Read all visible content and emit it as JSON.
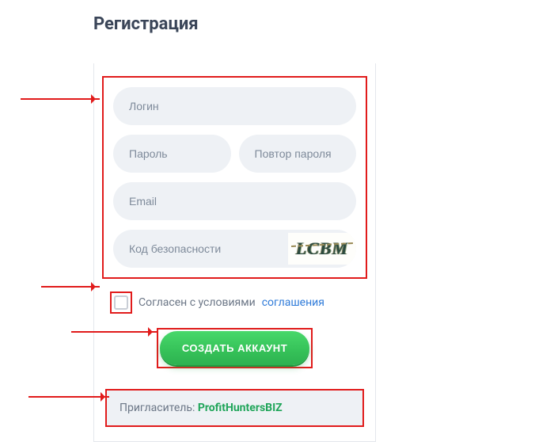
{
  "title": "Регистрация",
  "fields": {
    "login_placeholder": "Логин",
    "password_placeholder": "Пароль",
    "password_repeat_placeholder": "Повтор пароля",
    "email_placeholder": "Email",
    "captcha_placeholder": "Код безопасности",
    "captcha_text": "LCBM"
  },
  "agree": {
    "text": "Согласен с условиями ",
    "link_text": "соглашения"
  },
  "button_label": "СОЗДАТЬ АККАУНТ",
  "inviter": {
    "label": "Пригласитель: ",
    "name": "ProfitHuntersBIZ"
  }
}
